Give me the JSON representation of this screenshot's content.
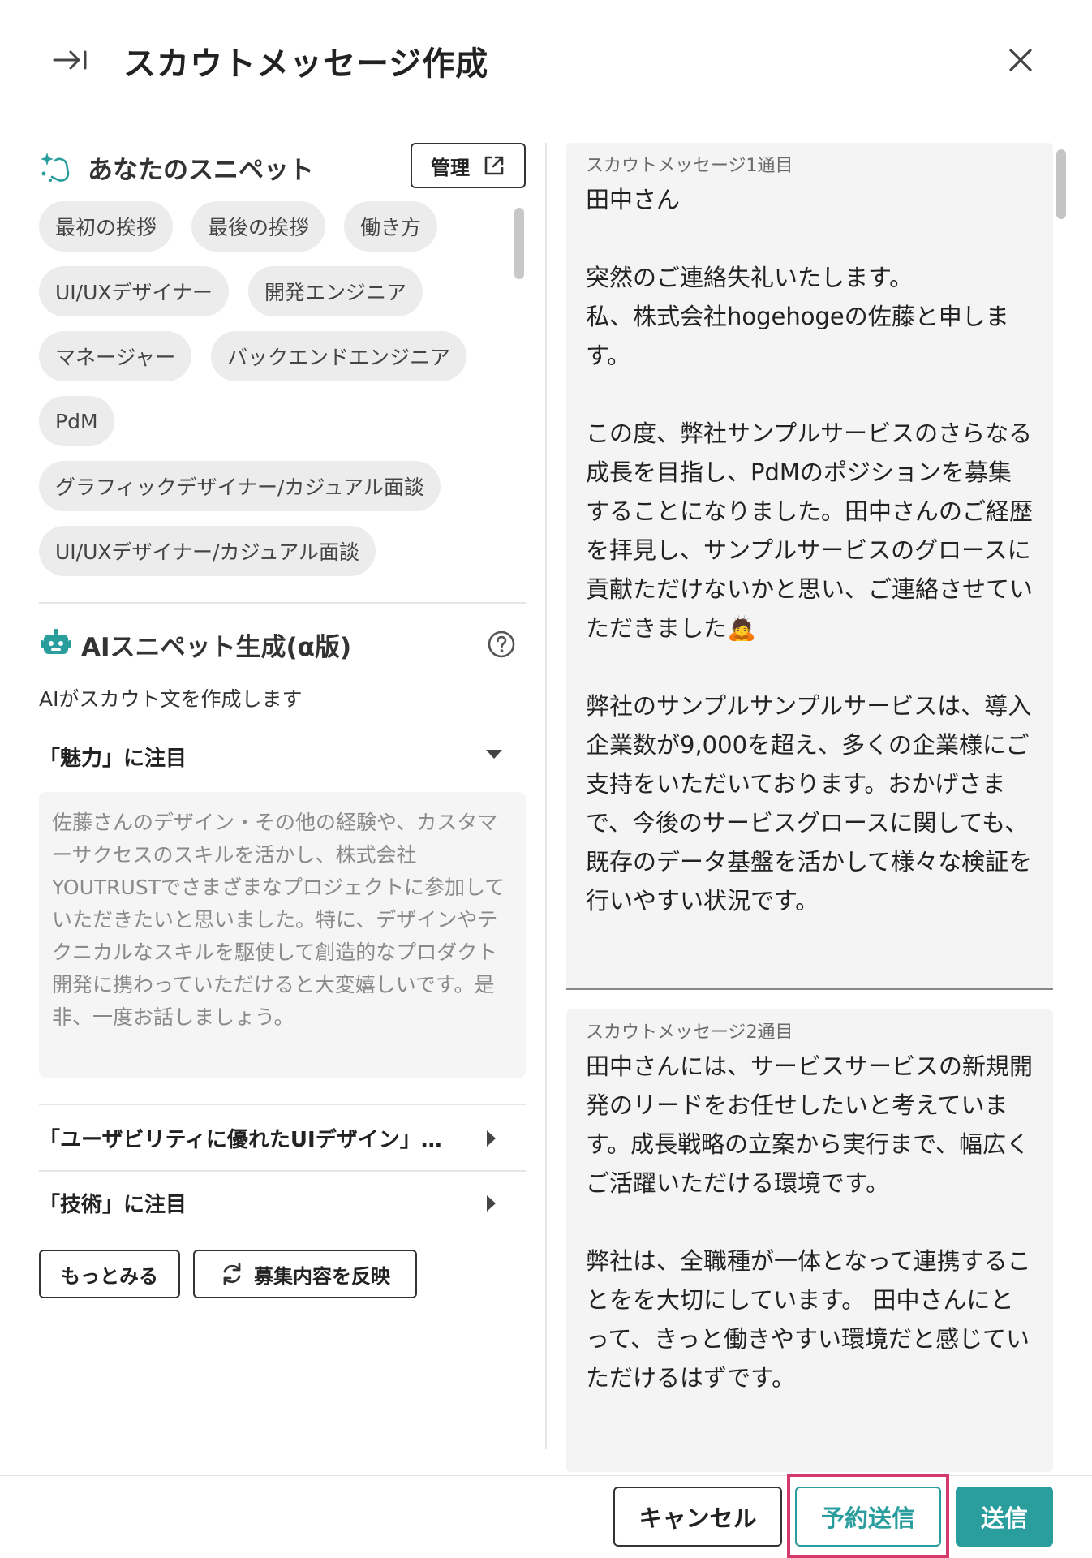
{
  "header": {
    "title": "スカウトメッセージ作成",
    "collapse_icon": "collapse-right-icon",
    "close_icon": "close-icon"
  },
  "snippets": {
    "title": "あなたのスニペット",
    "manage_label": "管理",
    "chips": [
      "最初の挨拶",
      "最後の挨拶",
      "働き方",
      "UI/UXデザイナー",
      "開発エンジニア",
      "マネージャー",
      "バックエンドエンジニア",
      "PdM",
      "グラフィックデザイナー/カジュアル面談",
      "UI/UXデザイナー/カジュアル面談"
    ]
  },
  "ai": {
    "title": "AIスニペット生成(α版)",
    "description": "AIがスカウト文を作成します",
    "accordions": [
      {
        "label": "「魅力」に注目",
        "expanded": true
      },
      {
        "label": "「ユーザビリティに優れたUIデザイン」に...",
        "expanded": false
      },
      {
        "label": "「技術」に注目",
        "expanded": false
      }
    ],
    "generated_text": "佐藤さんのデザイン・その他の経験や、カスタマーサクセスのスキルを活かし、株式会社YOUTRUSTでさまざまなプロジェクトに参加していただきたいと思いました。特に、デザインやテクニカルなスキルを駆使して創造的なプロダクト開発に携わっていただけると大変嬉しいです。是非、一度お話しましょう。",
    "more_label": "もっとみる",
    "reflect_label": "募集内容を反映"
  },
  "messages": [
    {
      "label": "スカウトメッセージ1通目",
      "body": "田中さん\n\n突然のご連絡失礼いたします。\n私、株式会社hogehogeの佐藤と申します。\n\nこの度、弊社サンプルサービスのさらなる成長を目指し、PdMのポジションを募集することになりました。田中さんのご経歴を拝見し、サンプルサービスのグロースに貢献ただけないかと思い、ご連絡させていただきました🙇\n\n弊社のサンプルサンプルサービスは、導入企業数が9,000を超え、多くの企業様にご支持をいただいております。おかげさまで、今後のサービスグロースに関しても、既存のデータ基盤を活かして様々な検証を行いやすい状況です。"
    },
    {
      "label": "スカウトメッセージ2通目",
      "body": "田中さんには、サービスサービスの新規開発のリードをお任せしたいと考えています。成長戦略の立案から実行まで、幅広くご活躍いただける環境です。\n\n弊社は、全職種が一体となって連携することをを大切にしています。 田中さんにとって、きっと働きやすい環境だと感じていただけるはずです。"
    }
  ],
  "footer": {
    "cancel_label": "キャンセル",
    "schedule_label": "予約送信",
    "send_label": "送信"
  },
  "colors": {
    "accent": "#2a9d9d",
    "highlight": "#d63a6a"
  }
}
